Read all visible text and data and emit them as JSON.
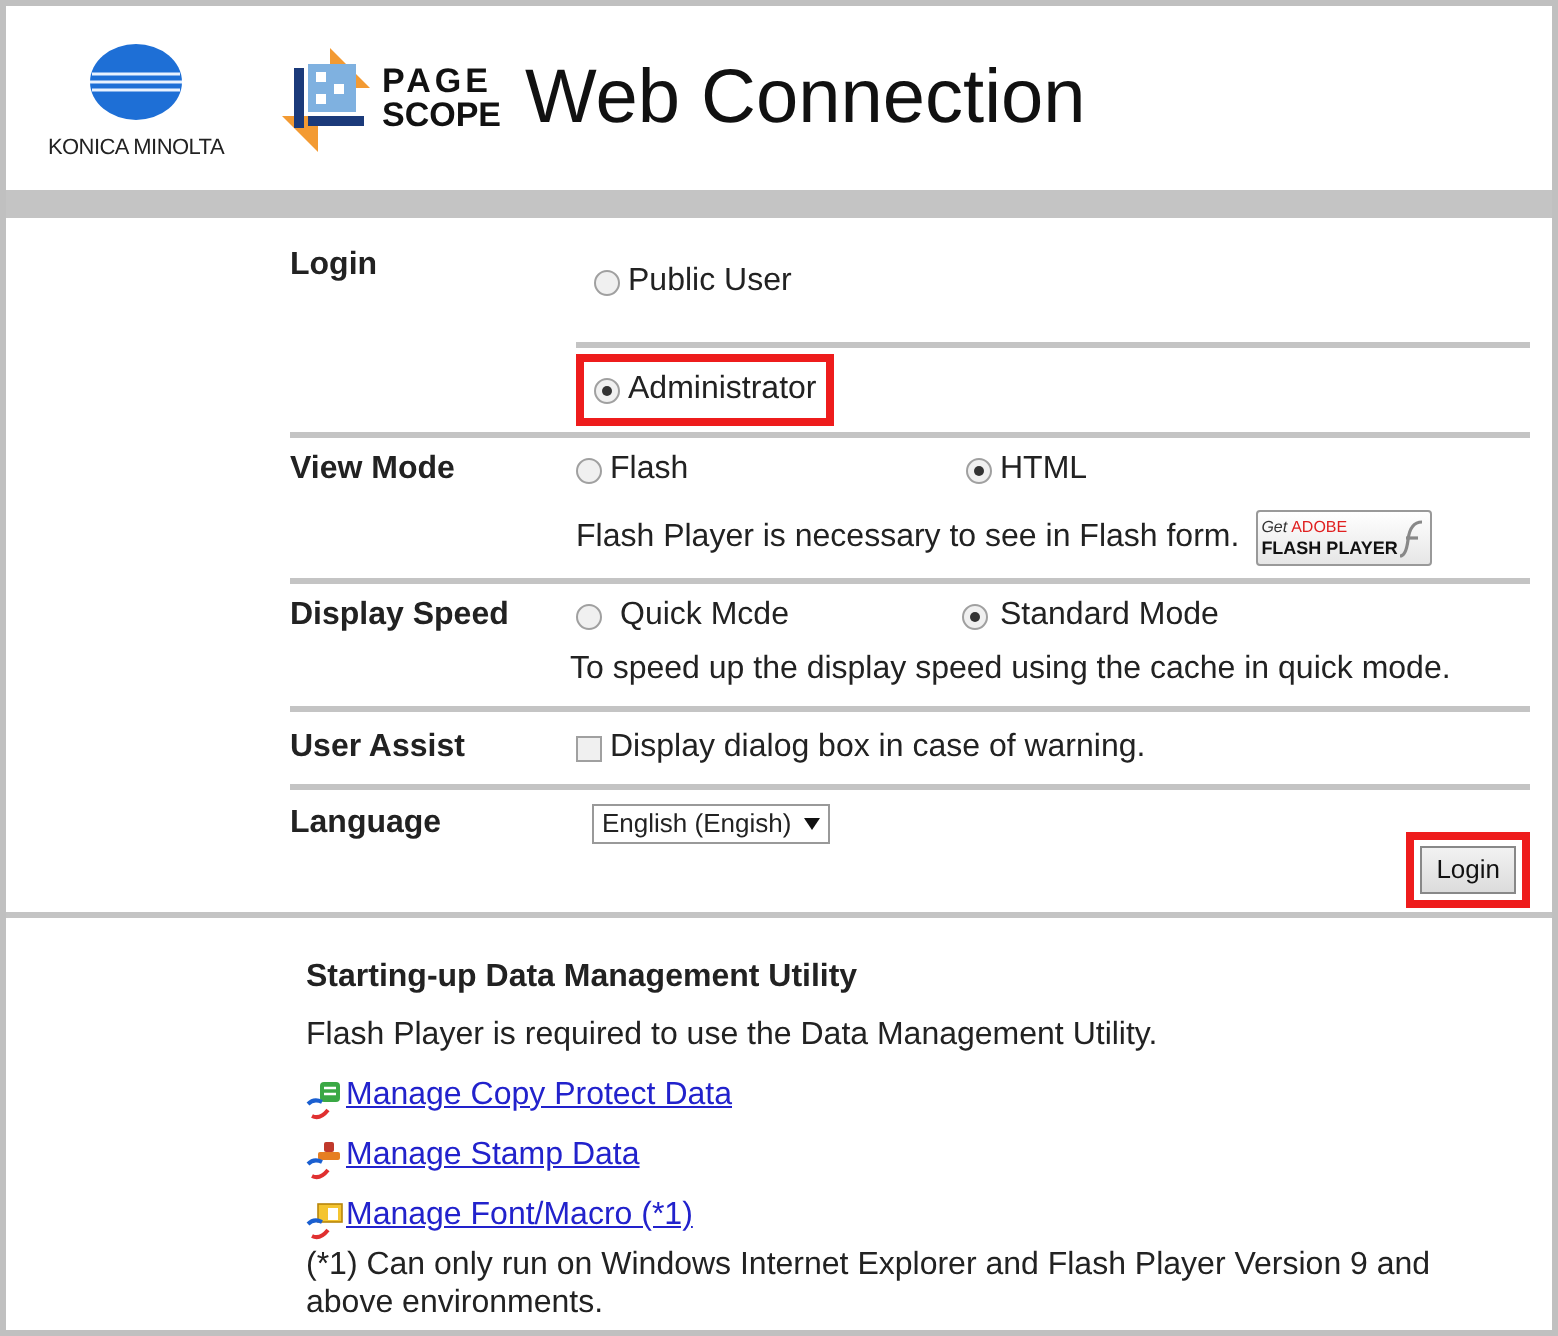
{
  "header": {
    "company": "KONICA MINOLTA",
    "product_top": "PAGE",
    "product_bottom": "SCOPE",
    "title": "Web Connection"
  },
  "login": {
    "label": "Login",
    "options": [
      {
        "label": "Public User",
        "selected": false,
        "highlighted": false
      },
      {
        "label": "Administrator",
        "selected": true,
        "highlighted": true
      }
    ]
  },
  "view_mode": {
    "label": "View Mode",
    "options": [
      {
        "label": "Flash",
        "selected": false
      },
      {
        "label": "HTML",
        "selected": true
      }
    ],
    "note": "Flash Player is necessary to see in Flash form.",
    "flash_badge": {
      "top_left": "Get",
      "top_right": "ADOBE",
      "bottom": "FLASH PLAYER"
    }
  },
  "display_speed": {
    "label": "Display Speed",
    "options": [
      {
        "label": "Quick Mcde",
        "selected": false
      },
      {
        "label": "Standard Mode",
        "selected": true
      }
    ],
    "note": "To speed up the display speed using the cache in quick mode."
  },
  "user_assist": {
    "label": "User Assist",
    "checkbox": {
      "label": "Display dialog box in case of warning.",
      "checked": false
    }
  },
  "language": {
    "label": "Language",
    "value": "English (Engish)"
  },
  "login_button": {
    "label": "Login",
    "highlighted": true
  },
  "utility": {
    "heading": "Starting-up Data Management Utility",
    "note": "Flash Player is required to use the Data Management Utility.",
    "links": [
      {
        "kind": "copy",
        "label": "Manage Copy Protect Data"
      },
      {
        "kind": "stamp",
        "label": "Manage Stamp Data"
      },
      {
        "kind": "font",
        "label": "Manage Font/Macro (*1)"
      }
    ],
    "footnote": "(*1) Can only run on Windows Internet Explorer and Flash Player Version 9 and above environments."
  }
}
